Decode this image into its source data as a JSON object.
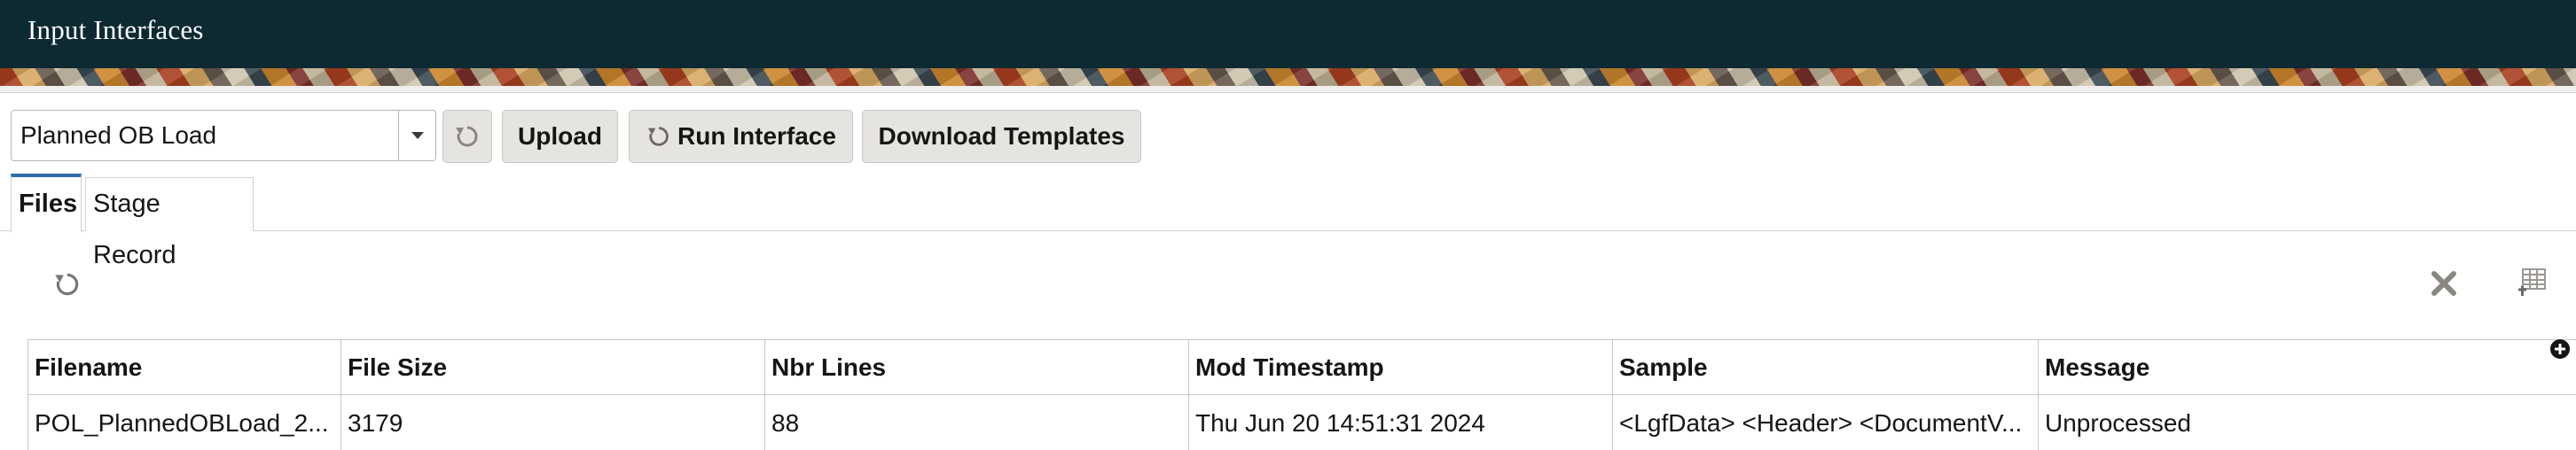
{
  "header": {
    "title": "Input Interfaces"
  },
  "toolbar": {
    "interface_select": {
      "value": "Planned OB Load"
    },
    "upload_label": "Upload",
    "run_interface_label": "Run Interface",
    "download_templates_label": "Download Templates"
  },
  "tabs": [
    {
      "label": "Files",
      "selected": true
    },
    {
      "label": "Stage Record",
      "selected": false
    }
  ],
  "grid": {
    "columns": [
      "Filename",
      "File Size",
      "Nbr Lines",
      "Mod Timestamp",
      "Sample",
      "Message"
    ],
    "rows": [
      {
        "filename": "POL_PlannedOBLoad_2...",
        "file_size": "3179",
        "nbr_lines": "88",
        "mod_timestamp": "Thu Jun 20 14:51:31 2024",
        "sample": "<LgfData> <Header> <DocumentV...",
        "message": "Unprocessed"
      }
    ]
  },
  "icons": {
    "refresh": "refresh-icon",
    "dropdown": "caret-down-icon",
    "clear": "close-icon",
    "columns": "column-settings-icon",
    "add_column": "plus-circle-icon"
  },
  "colors": {
    "header_bg": "#0d2a33",
    "selected_tab_accent": "#2b6cb0",
    "button_bg": "#e6e4e1"
  }
}
